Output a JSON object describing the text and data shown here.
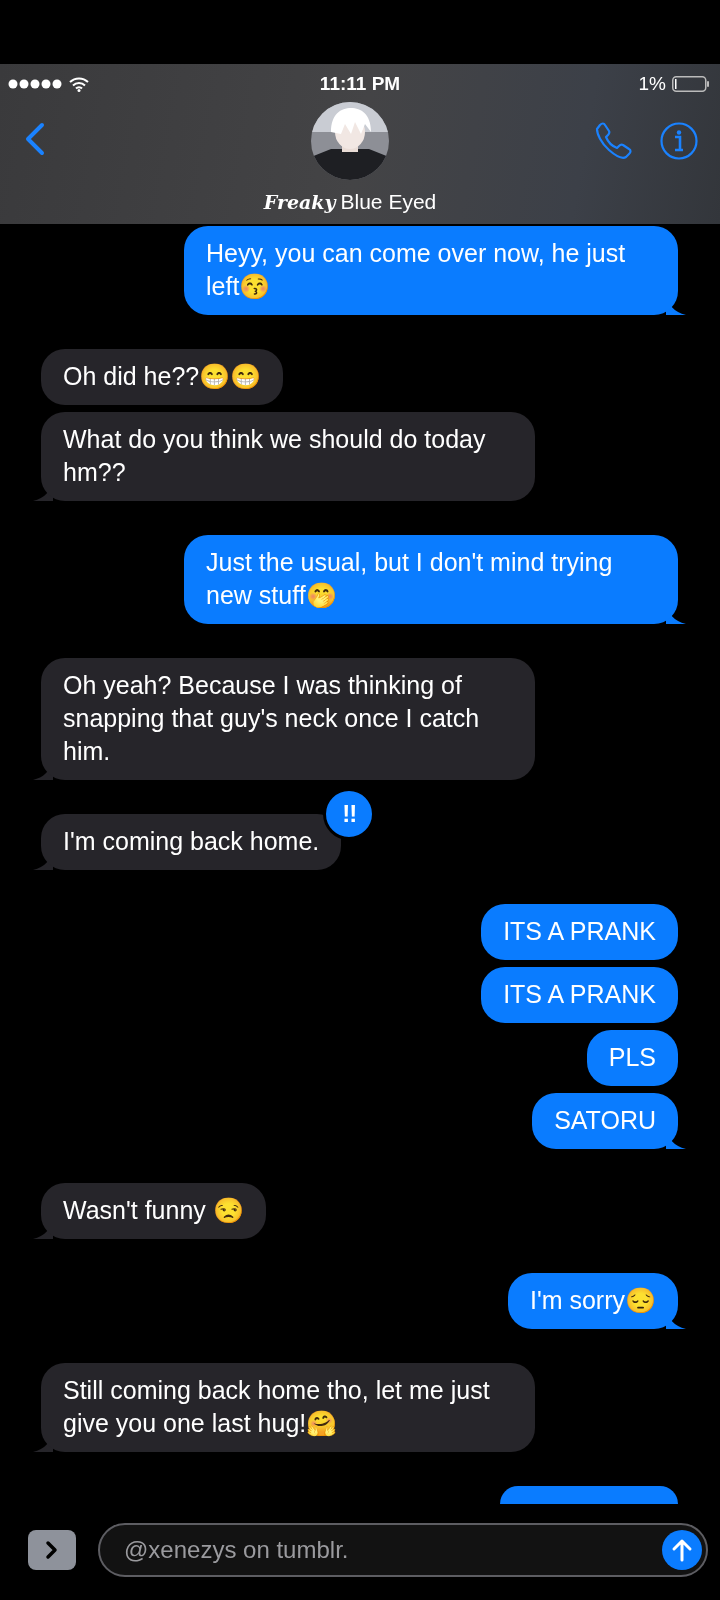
{
  "status_bar": {
    "time": "11:11 PM",
    "battery": "1%"
  },
  "contact": {
    "name_prefix": "Freaky",
    "name": "Blue Eyed"
  },
  "messages": [
    {
      "kind": "sent",
      "text": "Heyy, you can come over now, he just left😚",
      "tail": true
    },
    {
      "kind": "received",
      "text": "Oh did he??😁😁",
      "tail": false
    },
    {
      "kind": "received",
      "text": "What do you think we should do today hm??",
      "tail": true
    },
    {
      "kind": "sent",
      "text": "Just the usual, but I don't mind trying new stuff🤭",
      "tail": true
    },
    {
      "kind": "received",
      "text": "Oh yeah? Because I was thinking of snapping that guy's neck once I catch him.",
      "tail": true
    },
    {
      "kind": "received",
      "text": "I'm coming back home.",
      "tail": true,
      "reaction": "!!"
    },
    {
      "kind": "sent",
      "text": "ITS A PRANK",
      "tail": false
    },
    {
      "kind": "sent",
      "text": "ITS A PRANK",
      "tail": false
    },
    {
      "kind": "sent",
      "text": "PLS",
      "tail": false
    },
    {
      "kind": "sent",
      "text": "SATORU",
      "tail": true
    },
    {
      "kind": "received",
      "text": "Wasn't funny 😒",
      "tail": true
    },
    {
      "kind": "sent",
      "text": "I'm sorry😔",
      "tail": true
    },
    {
      "kind": "received",
      "text": "Still coming back home tho, let me just give you one last hug!🤗",
      "tail": true
    },
    {
      "kind": "partial"
    }
  ],
  "composer": {
    "value": "@xenezys on tumblr."
  }
}
